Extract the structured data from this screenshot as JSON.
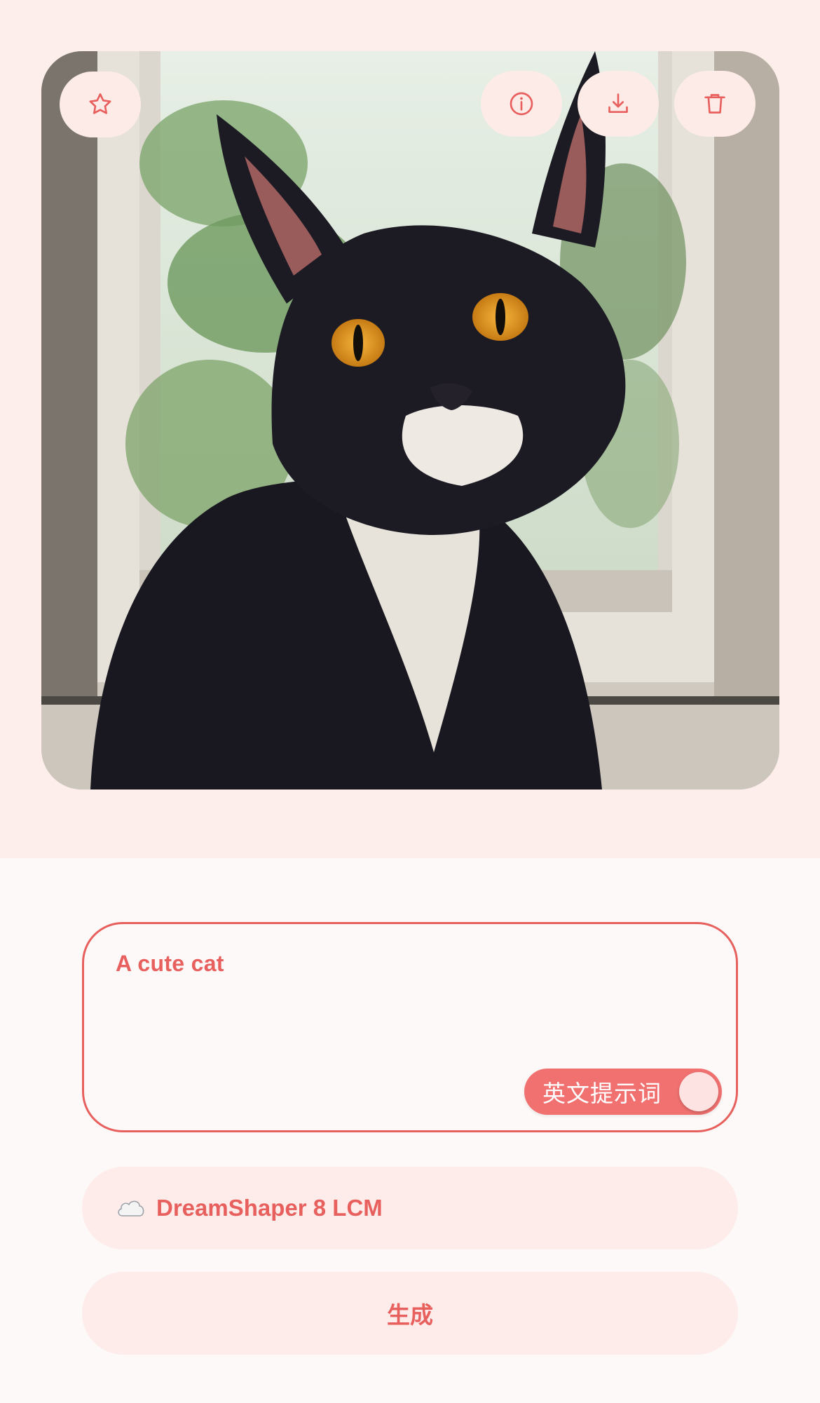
{
  "toolbar": {
    "favorite_icon": "star-icon",
    "info_icon": "info-icon",
    "download_icon": "download-icon",
    "delete_icon": "trash-icon"
  },
  "prompt": {
    "value": "A cute cat",
    "toggle_label": "英文提示词",
    "toggle_on": true
  },
  "model": {
    "icon": "cloud-icon",
    "label": "DreamShaper 8 LCM"
  },
  "generate": {
    "label": "生成"
  },
  "colors": {
    "accent": "#e8605e",
    "toggle_bg": "#f07170",
    "pill_bg": "#fdecea",
    "top_bg": "#fdeeeb"
  }
}
